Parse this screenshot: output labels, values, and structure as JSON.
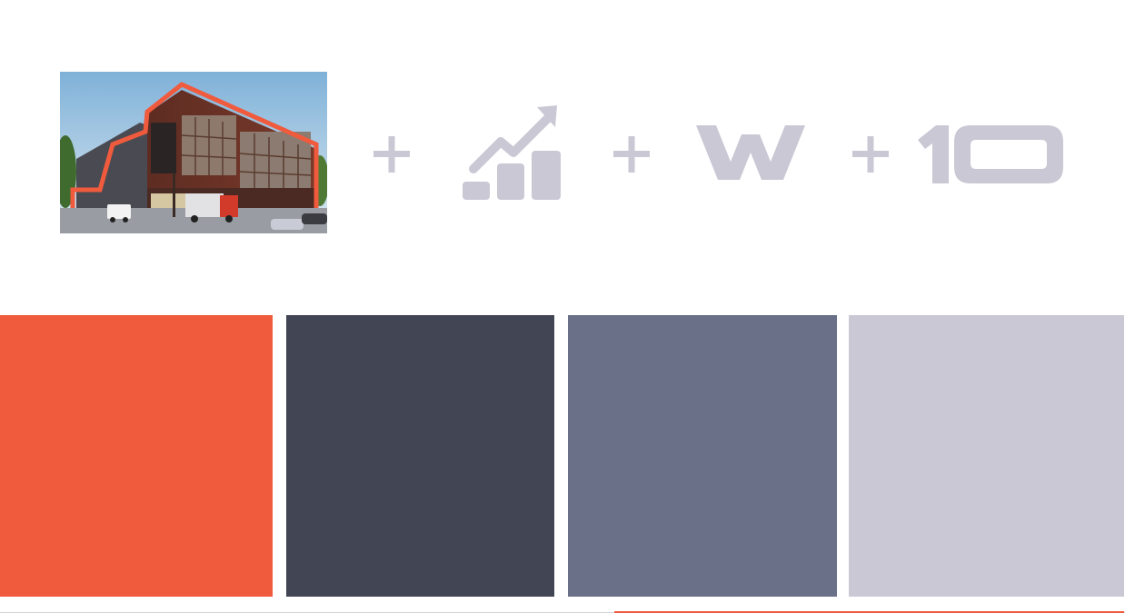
{
  "colors": {
    "accent": "#f05a3d",
    "icon_gray": "#cac8d4",
    "swatches": [
      "#f05a3d",
      "#424553",
      "#6a7088",
      "#cac8d4"
    ]
  },
  "icons": [
    "building-image",
    "plus-icon",
    "growth-chart-icon",
    "plus-icon",
    "w-logo-icon",
    "plus-icon",
    "ten-logo-icon"
  ],
  "logos": {
    "w_text": "W",
    "ten_text": "10"
  }
}
